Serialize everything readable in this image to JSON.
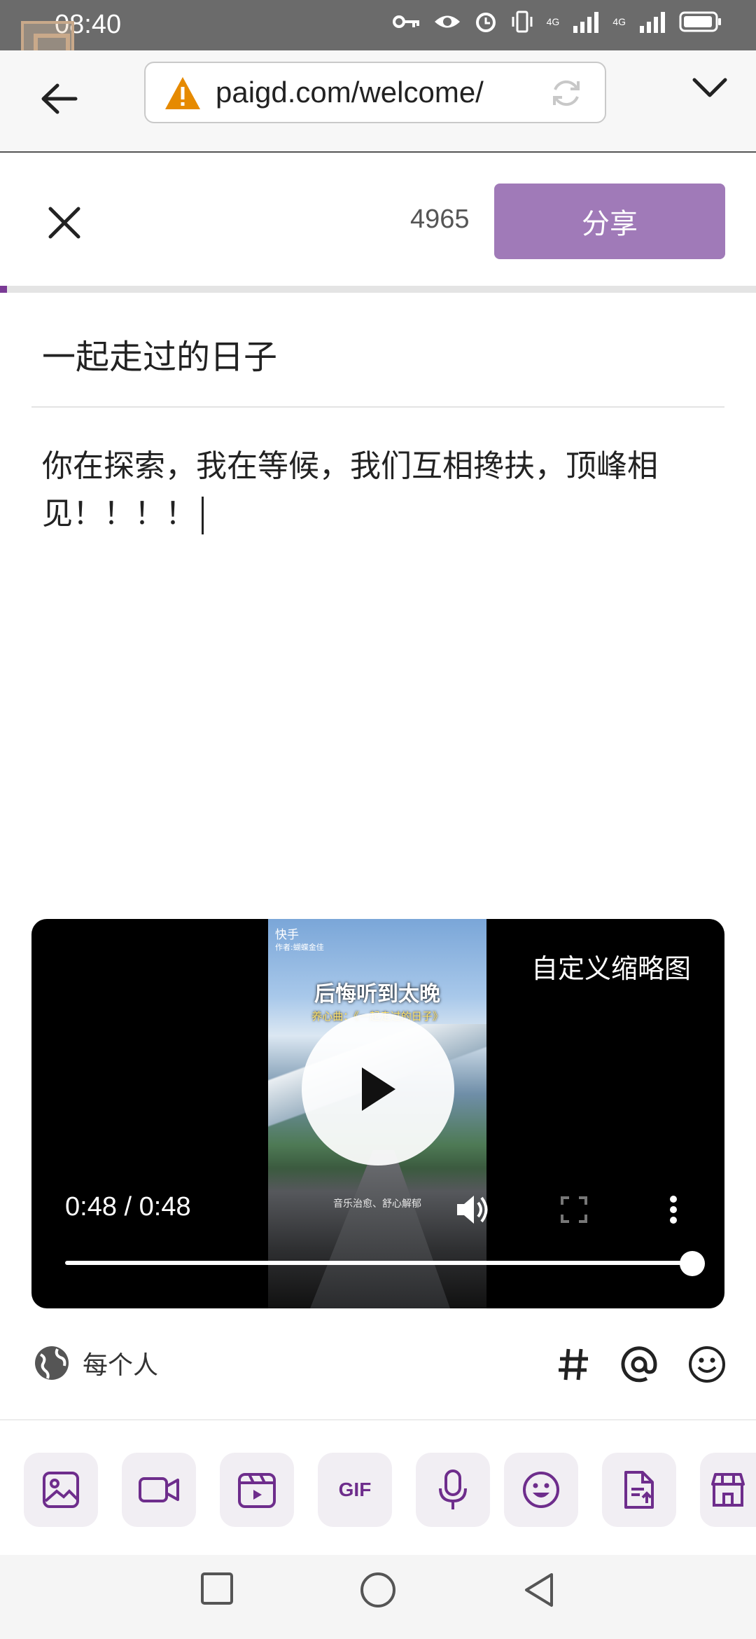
{
  "status_bar": {
    "time": "08:40",
    "network_1": "4G",
    "network_2": "4G"
  },
  "browser": {
    "url": "paigd.com/welcome/"
  },
  "compose": {
    "char_count": "4965",
    "share_label": "分享",
    "title": "一起走过的日子",
    "body": "你在探索，我在等候，我们互相搀扶，顶峰相见！！！！"
  },
  "video": {
    "thumb_logo": "快手",
    "thumb_author": "作者:蝴蝶金佳",
    "thumb_headline": "后悔听到太晚",
    "thumb_sub": "养心曲：《一起走过的日子》",
    "thumb_bottom": "音乐治愈、舒心解郁",
    "custom_thumbnail_label": "自定义缩略图",
    "time_display": "0:48 / 0:48",
    "progress": 1.0
  },
  "audience": {
    "label": "每个人"
  },
  "colors": {
    "accent": "#7a3a95",
    "share_button": "#a07ab8",
    "tool_bg": "#f1eef3"
  },
  "toolbar_icons": [
    "image-icon",
    "video-camera-icon",
    "clapperboard-icon",
    "gif-icon",
    "microphone-icon",
    "sticker-icon",
    "file-upload-icon",
    "store-icon"
  ]
}
